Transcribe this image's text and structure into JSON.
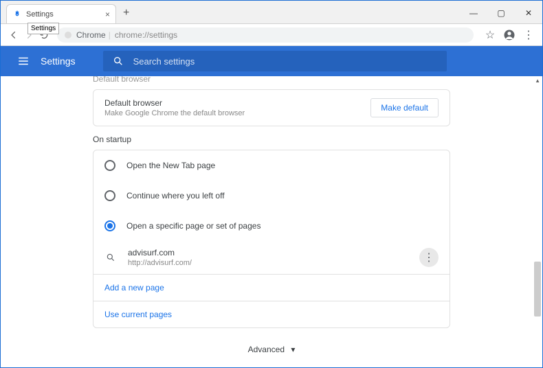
{
  "tab": {
    "title": "Settings",
    "tooltip": "Settings"
  },
  "omnibox": {
    "prefix": "Chrome",
    "url": "chrome://settings"
  },
  "header": {
    "title": "Settings",
    "search_placeholder": "Search settings"
  },
  "sections": {
    "default_browser_heading": "Default browser",
    "default_browser": {
      "title": "Default browser",
      "subtitle": "Make Google Chrome the default browser",
      "button": "Make default"
    },
    "on_startup_heading": "On startup",
    "radios": {
      "new_tab": "Open the New Tab page",
      "continue": "Continue where you left off",
      "specific": "Open a specific page or set of pages"
    },
    "page": {
      "name": "advisurf.com",
      "url": "http://advisurf.com/"
    },
    "add_page": "Add a new page",
    "use_current": "Use current pages"
  },
  "advanced_label": "Advanced",
  "colors": {
    "accent": "#1a73e8",
    "header_bg": "#2d70d4"
  }
}
